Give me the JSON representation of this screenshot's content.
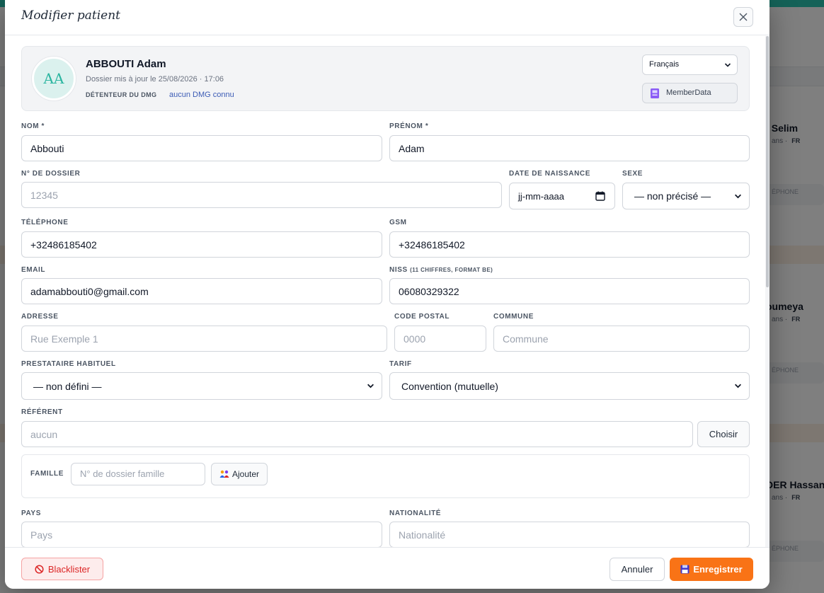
{
  "background": {
    "cards": [
      {
        "name": "l Selim",
        "sub": "ans ·",
        "lang": "FR",
        "chip": "ÉPHONE"
      },
      {
        "name": "oumeya",
        "sub": "ans ·",
        "lang": "FR",
        "chip": "ÉPHONE"
      },
      {
        "name": "DER Hassan",
        "sub": "ans ·",
        "lang": "FR",
        "chip": "ÉPHONE"
      }
    ]
  },
  "modal": {
    "title": "Modifier patient",
    "patient": {
      "initials": "AA",
      "name": "ABBOUTI Adam",
      "updated": "Dossier mis à jour le 25/08/2026 · 17:06",
      "dmg_label": "DÉTENTEUR DU DMG",
      "dmg_value": "aucun DMG connu",
      "language": "Français",
      "memberdata_label": "MemberData"
    },
    "fields": {
      "nom": {
        "label": "NOM *",
        "value": "Abbouti"
      },
      "prenom": {
        "label": "PRÉNOM *",
        "value": "Adam"
      },
      "dossier": {
        "label": "N° DE DOSSIER",
        "placeholder": "12345"
      },
      "naissance": {
        "label": "DATE DE NAISSANCE",
        "placeholder": "jj-mm-aaaa"
      },
      "sexe": {
        "label": "SEXE",
        "value": "— non précisé —"
      },
      "telephone": {
        "label": "TÉLÉPHONE",
        "value": "+32486185402"
      },
      "gsm": {
        "label": "GSM",
        "value": "+32486185402"
      },
      "email": {
        "label": "EMAIL",
        "value": "adamabbouti0@gmail.com"
      },
      "niss": {
        "label": "NISS",
        "label_hint": "(11 CHIFFRES, FORMAT BE)",
        "value": "06080329322"
      },
      "adresse": {
        "label": "ADRESSE",
        "placeholder": "Rue Exemple 1"
      },
      "code_postal": {
        "label": "CODE POSTAL",
        "placeholder": "0000"
      },
      "commune": {
        "label": "COMMUNE",
        "placeholder": "Commune"
      },
      "prestataire": {
        "label": "PRESTATAIRE HABITUEL",
        "value": "— non défini —"
      },
      "tarif": {
        "label": "TARIF",
        "value": "Convention (mutuelle)"
      },
      "referent": {
        "label": "RÉFÉRENT",
        "placeholder": "aucun",
        "button": "Choisir"
      },
      "famille": {
        "label": "FAMILLE",
        "placeholder": "N° de dossier famille",
        "button": "Ajouter"
      },
      "pays": {
        "label": "PAYS",
        "placeholder": "Pays"
      },
      "nationalite": {
        "label": "NATIONALITÉ",
        "placeholder": "Nationalité"
      }
    },
    "footer": {
      "blacklist": "Blacklister",
      "cancel": "Annuler",
      "save": "Enregistrer"
    }
  },
  "colors": {
    "accent": "#2bc4b0",
    "save": "#f97316",
    "danger": "#dc2626",
    "link": "#3b5bb5"
  }
}
